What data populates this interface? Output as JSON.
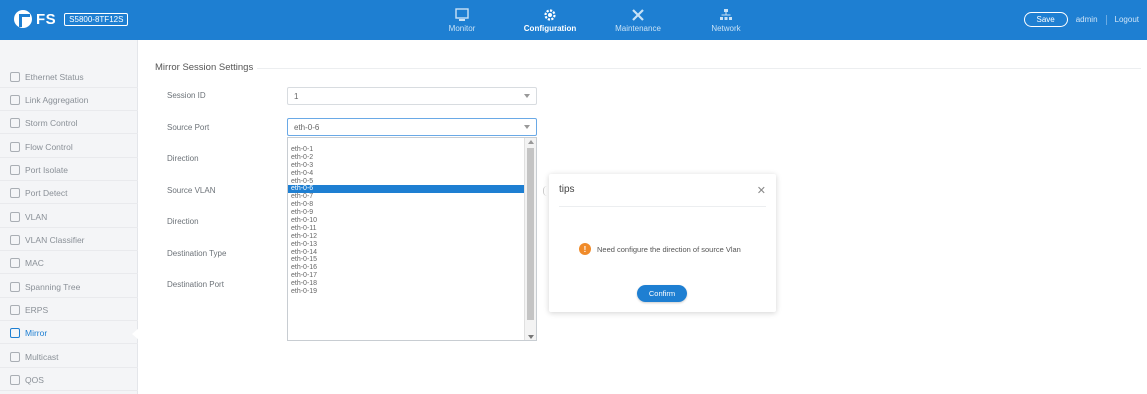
{
  "header": {
    "brand": "FS",
    "model": "S5800-8TF12S",
    "nav": [
      {
        "label": "Monitor",
        "icon": "monitor-icon",
        "active": false
      },
      {
        "label": "Configuration",
        "icon": "gear-icon",
        "active": true
      },
      {
        "label": "Maintenance",
        "icon": "tools-icon",
        "active": false
      },
      {
        "label": "Network",
        "icon": "network-icon",
        "active": false
      }
    ],
    "save_label": "Save",
    "user": "admin",
    "logout": "Logout"
  },
  "sidebar": {
    "items": [
      {
        "label": "Ethernet Status",
        "icon": "ethernet-icon"
      },
      {
        "label": "Link Aggregation",
        "icon": "link-icon"
      },
      {
        "label": "Storm Control",
        "icon": "storm-icon"
      },
      {
        "label": "Flow Control",
        "icon": "flow-icon"
      },
      {
        "label": "Port Isolate",
        "icon": "isolate-icon"
      },
      {
        "label": "Port Detect",
        "icon": "detect-icon"
      },
      {
        "label": "VLAN",
        "icon": "vlan-icon"
      },
      {
        "label": "VLAN Classifier",
        "icon": "classifier-icon"
      },
      {
        "label": "MAC",
        "icon": "mac-icon"
      },
      {
        "label": "Spanning Tree",
        "icon": "tree-icon"
      },
      {
        "label": "ERPS",
        "icon": "erps-icon"
      },
      {
        "label": "Mirror",
        "icon": "mirror-icon",
        "active": true
      },
      {
        "label": "Multicast",
        "icon": "multicast-icon"
      },
      {
        "label": "QOS",
        "icon": "qos-icon"
      }
    ]
  },
  "form": {
    "title": "Mirror Session Settings",
    "fields": {
      "session_id": {
        "label": "Session ID",
        "value": "1"
      },
      "source_port": {
        "label": "Source Port",
        "value": "eth-0-6"
      },
      "direction_1": {
        "label": "Direction"
      },
      "source_vlan": {
        "label": "Source VLAN"
      },
      "direction_2": {
        "label": "Direction"
      },
      "destination_type": {
        "label": "Destination Type"
      },
      "destination_port": {
        "label": "Destination Port"
      }
    }
  },
  "dropdown": {
    "selected": "eth-0-6",
    "options": [
      "eth-0-1",
      "eth-0-2",
      "eth-0-3",
      "eth-0-4",
      "eth-0-5",
      "eth-0-6",
      "eth-0-7",
      "eth-0-8",
      "eth-0-9",
      "eth-0-10",
      "eth-0-11",
      "eth-0-12",
      "eth-0-13",
      "eth-0-14",
      "eth-0-15",
      "eth-0-16",
      "eth-0-17",
      "eth-0-18",
      "eth-0-19"
    ]
  },
  "modal": {
    "title": "tips",
    "message": "Need configure the direction of source Vlan",
    "confirm_label": "Confirm",
    "warn_glyph": "!"
  },
  "colors": {
    "accent": "#1e7fd2",
    "warning": "#f08b2a"
  }
}
